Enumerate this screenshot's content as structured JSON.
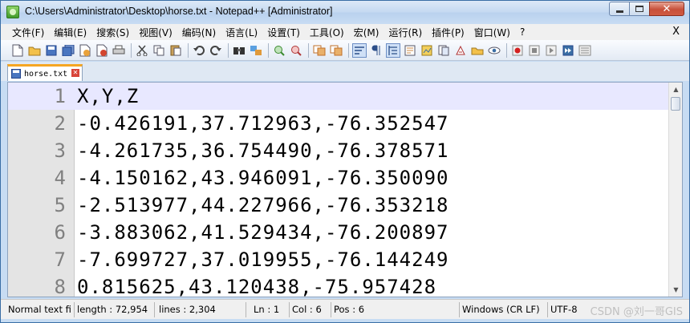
{
  "window": {
    "title": "C:\\Users\\Administrator\\Desktop\\horse.txt - Notepad++ [Administrator]",
    "app_icon": "notepadpp-icon"
  },
  "menu": {
    "items": [
      "文件(F)",
      "编辑(E)",
      "搜索(S)",
      "视图(V)",
      "编码(N)",
      "语言(L)",
      "设置(T)",
      "工具(O)",
      "宏(M)",
      "运行(R)",
      "插件(P)",
      "窗口(W)",
      "?"
    ],
    "close_label": "X"
  },
  "toolbar": {
    "icons": [
      "new-file-icon",
      "open-file-icon",
      "save-icon",
      "save-all-icon",
      "close-icon",
      "close-all-icon",
      "print-icon",
      "cut-icon",
      "copy-icon",
      "paste-icon",
      "undo-icon",
      "redo-icon",
      "find-icon",
      "replace-icon",
      "zoom-in-icon",
      "zoom-out-icon",
      "sync-vertical-icon",
      "sync-horizontal-icon",
      "word-wrap-icon",
      "show-all-chars-icon",
      "indent-guide-icon",
      "udl-icon",
      "doc-map-icon",
      "function-list-icon",
      "folder-workspace-icon",
      "monitoring-icon",
      "record-macro-icon",
      "stop-record-icon",
      "play-macro-icon",
      "run-macro-multiple-icon",
      "save-macro-icon"
    ]
  },
  "tabs": [
    {
      "label": "horse.txt"
    }
  ],
  "editor": {
    "lines": [
      {
        "num": "1",
        "text": "X,Y,Z"
      },
      {
        "num": "2",
        "text": "-0.426191,37.712963,-76.352547"
      },
      {
        "num": "3",
        "text": "-4.261735,36.754490,-76.378571"
      },
      {
        "num": "4",
        "text": "-4.150162,43.946091,-76.350090"
      },
      {
        "num": "5",
        "text": "-2.513977,44.227966,-76.353218"
      },
      {
        "num": "6",
        "text": "-3.883062,41.529434,-76.200897"
      },
      {
        "num": "7",
        "text": "-7.699727,37.019955,-76.144249"
      },
      {
        "num": "8",
        "text": "0.815625,43.120438,-75.957428"
      }
    ]
  },
  "status": {
    "type": "Normal text fi",
    "length": "length : 72,954",
    "lines": "lines : 2,304",
    "ln": "Ln : 1",
    "col": "Col : 6",
    "pos": "Pos : 6",
    "eol": "Windows (CR LF)",
    "encoding": "UTF-8",
    "watermark": "CSDN @刘一哥GIS"
  }
}
